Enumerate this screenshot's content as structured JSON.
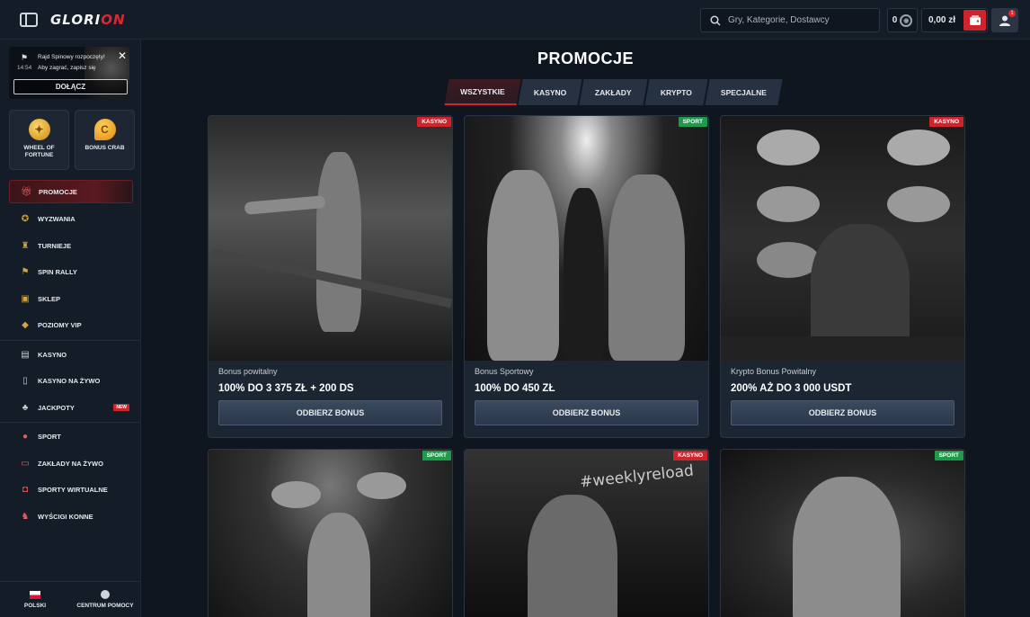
{
  "header": {
    "logo": "GLORION",
    "search_placeholder": "Gry, Kategorie, Dostawcy",
    "coins": "0",
    "balance": "0,00 zł",
    "user_badge": "1"
  },
  "notification": {
    "title": "Rajd Spinowy rozpoczęty!",
    "time": "14:54",
    "text": "Aby zagrać, zapisz się",
    "join_label": "DOŁĄCZ"
  },
  "tiles": [
    {
      "label": "WHEEL OF FORTUNE",
      "icon": "wheel-of-fortune-icon"
    },
    {
      "label": "BONUS CRAB",
      "icon": "bonus-crab-icon"
    }
  ],
  "nav": {
    "items": [
      {
        "label": "PROMOCJE",
        "icon": "gift-icon"
      },
      {
        "label": "WYZWANIA",
        "icon": "medal-icon"
      },
      {
        "label": "TURNIEJE",
        "icon": "trophy-icon"
      },
      {
        "label": "SPIN RALLY",
        "icon": "flag-icon"
      },
      {
        "label": "SKLEP",
        "icon": "shop-icon"
      },
      {
        "label": "POZIOMY VIP",
        "icon": "diamond-icon"
      },
      {
        "label": "KASYNO",
        "icon": "slot-machine-icon"
      },
      {
        "label": "KASYNO NA ŻYWO",
        "icon": "cards-icon"
      },
      {
        "label": "JACKPOTY",
        "icon": "clover-icon",
        "badge": "NEW"
      },
      {
        "label": "SPORT",
        "icon": "ball-icon"
      },
      {
        "label": "ZAKŁADY NA ŻYWO",
        "icon": "live-icon"
      },
      {
        "label": "SPORTY WIRTUALNE",
        "icon": "virtual-icon"
      },
      {
        "label": "WYŚCIGI KONNE",
        "icon": "horse-icon"
      }
    ]
  },
  "footer": {
    "language": "POLSKI",
    "help": "CENTRUM POMOCY"
  },
  "main": {
    "title": "PROMOCJE",
    "tabs": [
      "WSZYSTKIE",
      "KASYNO",
      "ZAKŁADY",
      "KRYPTO",
      "SPECJALNE"
    ],
    "cards": [
      {
        "tag": "KASYNO",
        "subtitle": "Bonus powitalny",
        "title": "100% DO 3 375 ZŁ + 200 DS",
        "button": "ODBIERZ BONUS"
      },
      {
        "tag": "SPORT",
        "subtitle": "Bonus Sportowy",
        "title": "100% DO 450 ZŁ",
        "button": "ODBIERZ BONUS"
      },
      {
        "tag": "KASYNO",
        "subtitle": "Krypto Bonus Powitalny",
        "title": "200% AŻ DO 3 000 USDT",
        "button": "ODBIERZ BONUS"
      },
      {
        "tag": "SPORT"
      },
      {
        "tag": "KASYNO",
        "image_text": "#weeklyreload"
      },
      {
        "tag": "SPORT"
      }
    ]
  }
}
